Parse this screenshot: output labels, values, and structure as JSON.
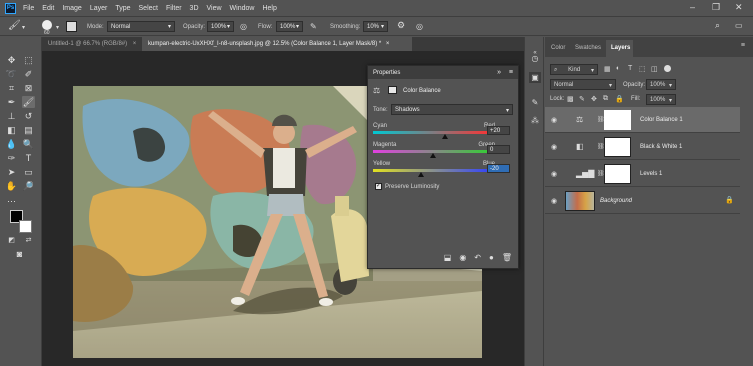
{
  "menu": {
    "app_logo": "Ps",
    "items": [
      "File",
      "Edit",
      "Image",
      "Layer",
      "Type",
      "Select",
      "Filter",
      "3D",
      "View",
      "Window",
      "Help"
    ],
    "window_controls": [
      "–",
      "❐",
      "✕"
    ]
  },
  "options_bar": {
    "brush_size": "60",
    "mode_label": "Mode:",
    "mode_value": "Normal",
    "opacity_label": "Opacity:",
    "opacity_value": "100%",
    "flow_label": "Flow:",
    "flow_value": "100%",
    "smoothing_label": "Smoothing:",
    "smoothing_value": "10%"
  },
  "doc_tabs": [
    {
      "label": "Untitled-1 @ 66.7% (RGB/8#)",
      "close": "×"
    },
    {
      "label": "kumpan-electric-UxXHXf_I-n8-unsplash.jpg @ 12.5% (Color Balance 1, Layer Mask/8) *",
      "close": "×"
    }
  ],
  "properties": {
    "header": "Properties",
    "collapse": "»",
    "menu": "≡",
    "title": "Color Balance",
    "tone_label": "Tone:",
    "tone_value": "Shadows",
    "sliders": [
      {
        "left": "Cyan",
        "right": "Red",
        "value": "+20",
        "level": 0.6,
        "colors": [
          "#00c8d2",
          "#ff3030"
        ]
      },
      {
        "left": "Magenta",
        "right": "Green",
        "value": "0",
        "level": 0.5,
        "colors": [
          "#e040e0",
          "#30d030"
        ]
      },
      {
        "left": "Yellow",
        "right": "Blue",
        "value": "-20",
        "level": 0.4,
        "colors": [
          "#e0e020",
          "#3040ff"
        ]
      }
    ],
    "preserve_label": "Preserve Luminosity",
    "preserve_checked": true
  },
  "layers_panel": {
    "tabs": [
      "Color",
      "Swatches",
      "Layers"
    ],
    "active_tab": "Layers",
    "kind_label": "Kind",
    "blend_mode": "Normal",
    "opacity_label": "Opacity:",
    "opacity_value": "100%",
    "lock_label": "Lock:",
    "fill_label": "Fill:",
    "fill_value": "100%",
    "layers": [
      {
        "name": "Color Balance 1",
        "type": "adjustment",
        "icon": "color-balance-icon",
        "selected": true
      },
      {
        "name": "Black & White 1",
        "type": "adjustment",
        "icon": "black-white-icon",
        "selected": false
      },
      {
        "name": "Levels 1",
        "type": "adjustment",
        "icon": "levels-icon",
        "selected": false
      },
      {
        "name": "Background",
        "type": "image",
        "icon": "lock-icon",
        "selected": false
      }
    ]
  },
  "colors": {
    "ui_bg": "#535353",
    "ui_dark": "#3a3a3a",
    "canvas_bg": "#282828",
    "accent": "#31a8ff"
  }
}
